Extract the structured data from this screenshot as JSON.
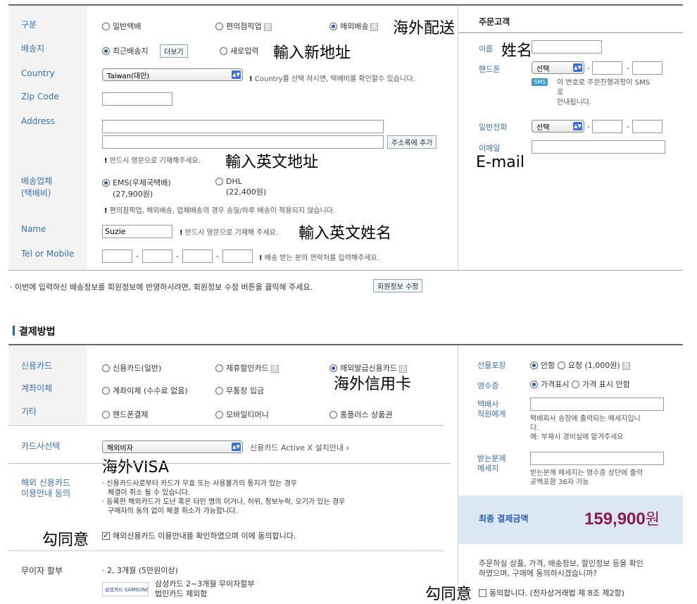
{
  "delivery": {
    "type_label": "구분",
    "type_options": [
      "일반택배",
      "편의점픽업",
      "해외배송"
    ],
    "type_annotation": "海外配送",
    "dest_label": "배송지",
    "dest_recent": "최근배송지",
    "dest_more_button": "더보기",
    "dest_new": "새로입력",
    "dest_annotation": "輸入新地址",
    "country_label": "Country",
    "country_value": "Taiwan(대만)",
    "country_note": "Country를 선택 하시면, 택배비를 확인할수 있습니다.",
    "zip_label": "Zip Code",
    "address_label": "Address",
    "address_button": "주소록에 추가",
    "address_note": "반드시 영문으로 기재해주세요.",
    "address_annotation": "輸入英文地址",
    "carrier_label_1": "배송업체",
    "carrier_label_2": "(택배비)",
    "carrier_ems": "EMS(우체국택배)",
    "carrier_ems_price": "(27,900원)",
    "carrier_dhl": "DHL",
    "carrier_dhl_price": "(22,400원)",
    "carrier_note": "편의점픽업, 해외배송, 업체배송의 경우 송일/하루 배송이 적용되지 않습니다.",
    "name_label": "Name",
    "name_value": "Suzie",
    "name_note": "반드시 영문으로 기재해 주세요.",
    "name_annotation": "輸入英文姓名",
    "tel_label": "Tel or Mobile",
    "tel_note": "배송 받는 분의 연락처를 입력해주세요."
  },
  "orderer": {
    "title": "주문고객",
    "name_label": "이름",
    "name_annotation": "姓名",
    "mobile_label": "핸드폰",
    "mobile_select": "선택",
    "sms_badge": "SMS",
    "sms_note_1": "이 번호로 주문진행과정이 SMS",
    "sms_note_2": "로",
    "sms_note_3": "안내됩니다.",
    "phone_label": "일반전화",
    "phone_select": "선택",
    "email_label": "이메일",
    "email_annotation": "E-mail"
  },
  "member_note": "이번에 입력하신 배송정보를 회원정보에 반영하시려면, 회원정보 수정 버튼을 클릭해 주세요.",
  "member_button": "회원정보 수정",
  "payment": {
    "title": "결제방법",
    "credit_label": "신용카드",
    "credit_options": [
      "신용카드(일반)",
      "제휴할인카드",
      "해외발급신용카드"
    ],
    "credit_annotation": "海外信用卡",
    "transfer_label": "계좌이체",
    "transfer_options": [
      "계좌이체 (수수료 없음)",
      "무통장 입금"
    ],
    "etc_label": "기타",
    "etc_options": [
      "핸드폰결제",
      "모바일티머니",
      "홈플러스 상품권"
    ],
    "card_select_label": "카드사선택",
    "card_select_value": "해외비자",
    "card_install_link": "신용카드 Active X 설치안내",
    "card_annotation": "海外VISA",
    "overseas_label_1": "해외 신용카드",
    "overseas_label_2": "이용안내 동의",
    "overseas_text_1": "신용카드사로부터 카드가 무효 또는 사용불가의 통지가 있는 경우",
    "overseas_text_1b": "체결이 취소 될 수 있습니다.",
    "overseas_text_2": "등록한 해외카드가 도난 혹은 타인 명의 이거나, 허위, 정보누락, 오기가 있는 경우",
    "overseas_text_2b": "구매자의 동의 없이 체결 취소가 가능합니다.",
    "agree_text": "해외신용카드 이용안내를 확인하였으며 이에 동의합니다.",
    "agree_annotation": "勾同意",
    "installment_label": "무이자 할부",
    "installment_text": "2, 3개월 (5만원이상)",
    "samsung_logo": "삼성카드 SAMSUNG",
    "samsung_text_1": "삼성카드 2~3개월 무이자할부",
    "samsung_text_2": "법인카드 제외함"
  },
  "extras": {
    "gift_label": "선물포장",
    "gift_no": "안함",
    "gift_yes": "요청 (1,000원)",
    "receipt_label": "영수증",
    "receipt_show": "가격표시",
    "receipt_hide": "가격 표시 안함",
    "courier_label_1": "택배사",
    "courier_label_2": "직원에게",
    "courier_note_1": "택배회사 송장에 출력되는 메세지입니",
    "courier_note_2": "다.",
    "courier_note_3": "예: 부재시 경비실에 맡겨주세요",
    "recipient_label_1": "받는분께",
    "recipient_label_2": "메세지",
    "recipient_note_1": "받는분께 메세지는 영수증 상단에 출력",
    "recipient_note_2": "공백포함 36자 가능",
    "total_label": "최종 결제금액",
    "total_value": "159,900",
    "total_unit": "원",
    "confirm_text_1": "주문하실 상품, 가격, 배송정보, 할인정보 등을 확인",
    "confirm_text_2": "하였으며, 구매에 동의하시겠습니까?",
    "final_agree": "동의합니다. (전자상거래법 제 8조 제2항)",
    "final_annotation": "勾同意"
  },
  "colors": {
    "label": "#3a6fb0",
    "total": "#8b1a4a",
    "total_bg": "#dbe8f4"
  }
}
